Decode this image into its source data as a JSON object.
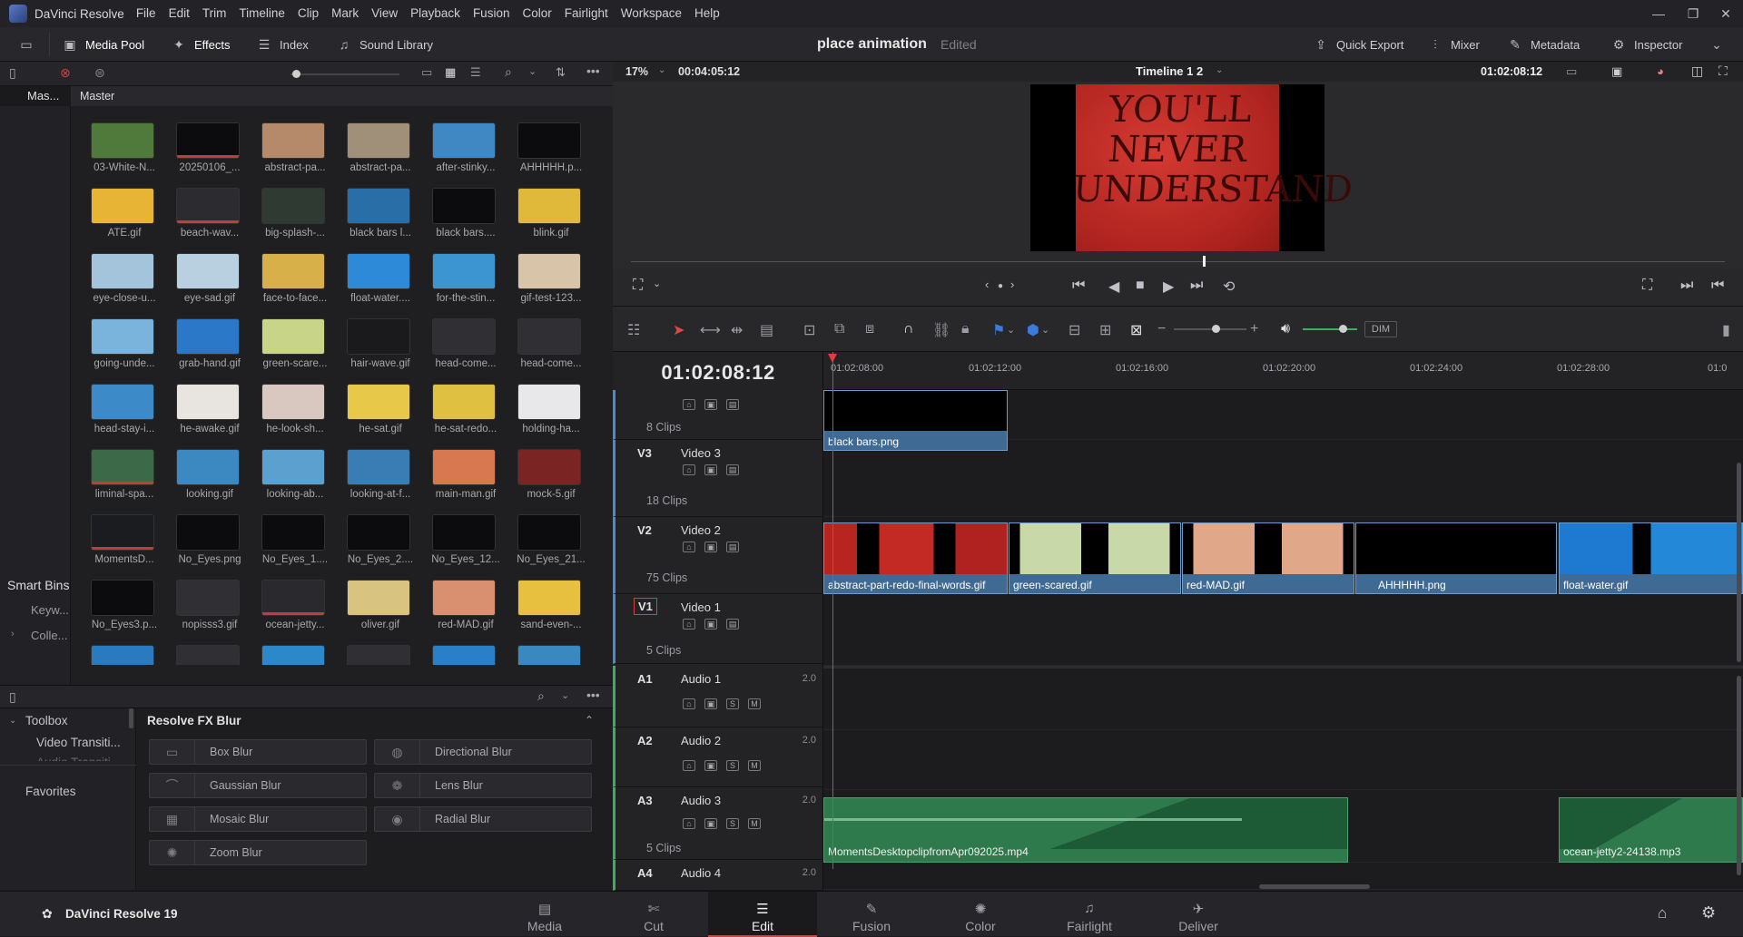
{
  "menubar": {
    "app_name": "DaVinci Resolve",
    "items": [
      "File",
      "Edit",
      "Trim",
      "Timeline",
      "Clip",
      "Mark",
      "View",
      "Playback",
      "Fusion",
      "Color",
      "Fairlight",
      "Workspace",
      "Help"
    ]
  },
  "toolbar": {
    "media_pool": "Media Pool",
    "effects": "Effects",
    "index": "Index",
    "sound_library": "Sound Library",
    "project_title": "place animation",
    "project_status": "Edited",
    "quick_export": "Quick Export",
    "mixer": "Mixer",
    "metadata": "Metadata",
    "inspector": "Inspector"
  },
  "bins": {
    "master_short": "Mas...",
    "smart_bins": "Smart Bins",
    "keywords": "Keyw...",
    "collections": "Colle..."
  },
  "pool": {
    "header": "Master",
    "clips": [
      {
        "name": "03-White-N...",
        "color": "#4f7a3c",
        "red": false
      },
      {
        "name": "20250106_...",
        "color": "#0c0c0e",
        "red": true
      },
      {
        "name": "abstract-pa...",
        "color": "#b58a6a",
        "red": false
      },
      {
        "name": "abstract-pa...",
        "color": "#a0907a",
        "red": false
      },
      {
        "name": "after-stinky...",
        "color": "#3f88c4",
        "red": false
      },
      {
        "name": "AHHHHH.p...",
        "color": "#0c0c0e",
        "red": false
      },
      {
        "name": "ATE.gif",
        "color": "#e7b435",
        "red": false
      },
      {
        "name": "beach-wav...",
        "color": "#2c2c30",
        "red": true
      },
      {
        "name": "big-splash-...",
        "color": "#2f3a33",
        "red": false
      },
      {
        "name": "black bars l...",
        "color": "#2a6ea8",
        "red": false
      },
      {
        "name": "black bars....",
        "color": "#0c0c0e",
        "red": false
      },
      {
        "name": "blink.gif",
        "color": "#e0b83a",
        "red": false
      },
      {
        "name": "eye-close-u...",
        "color": "#a4c4dc",
        "red": false
      },
      {
        "name": "eye-sad.gif",
        "color": "#b8d0e0",
        "red": false
      },
      {
        "name": "face-to-face...",
        "color": "#d8b04a",
        "red": false
      },
      {
        "name": "float-water....",
        "color": "#2c8ad8",
        "red": false
      },
      {
        "name": "for-the-stin...",
        "color": "#3c94d0",
        "red": false
      },
      {
        "name": "gif-test-123...",
        "color": "#d8c4a8",
        "red": false
      },
      {
        "name": "going-unde...",
        "color": "#7ab4dc",
        "red": false
      },
      {
        "name": "grab-hand.gif",
        "color": "#2c78c8",
        "red": false
      },
      {
        "name": "green-scare...",
        "color": "#c8d488",
        "red": false
      },
      {
        "name": "hair-wave.gif",
        "color": "#1a1a1c",
        "red": false
      },
      {
        "name": "head-come...",
        "color": "#303034",
        "red": false
      },
      {
        "name": "head-come...",
        "color": "#303034",
        "red": false
      },
      {
        "name": "head-stay-i...",
        "color": "#3c8ac8",
        "red": false
      },
      {
        "name": "he-awake.gif",
        "color": "#e8e4e0",
        "red": false
      },
      {
        "name": "he-look-sh...",
        "color": "#d8c8c0",
        "red": false
      },
      {
        "name": "he-sat.gif",
        "color": "#e8c848",
        "red": false
      },
      {
        "name": "he-sat-redo...",
        "color": "#e0c040",
        "red": false
      },
      {
        "name": "holding-ha...",
        "color": "#e8e8ea",
        "red": false
      },
      {
        "name": "liminal-spa...",
        "color": "#3c6a48",
        "red": true
      },
      {
        "name": "looking.gif",
        "color": "#3c88c0",
        "red": false
      },
      {
        "name": "looking-ab...",
        "color": "#5ca0d0",
        "red": false
      },
      {
        "name": "looking-at-f...",
        "color": "#3a7cb4",
        "red": false
      },
      {
        "name": "main-man.gif",
        "color": "#d87850",
        "red": false
      },
      {
        "name": "mock-5.gif",
        "color": "#7a2424",
        "red": false
      },
      {
        "name": "MomentsD...",
        "color": "#1a1c20",
        "red": true
      },
      {
        "name": "No_Eyes.png",
        "color": "#0c0c0e",
        "red": false
      },
      {
        "name": "No_Eyes_1....",
        "color": "#0c0c0e",
        "red": false
      },
      {
        "name": "No_Eyes_2....",
        "color": "#0c0c0e",
        "red": false
      },
      {
        "name": "No_Eyes_12...",
        "color": "#0c0c0e",
        "red": false
      },
      {
        "name": "No_Eyes_21...",
        "color": "#0c0c0e",
        "red": false
      },
      {
        "name": "No_Eyes3.p...",
        "color": "#0c0c0e",
        "red": false
      },
      {
        "name": "nopisss3.gif",
        "color": "#303034",
        "red": false
      },
      {
        "name": "ocean-jetty...",
        "color": "#2a2a2e",
        "red": true
      },
      {
        "name": "oliver.gif",
        "color": "#d8c480",
        "red": false
      },
      {
        "name": "red-MAD.gif",
        "color": "#d89070",
        "red": false
      },
      {
        "name": "sand-even-...",
        "color": "#e8c040",
        "red": false
      }
    ]
  },
  "fx": {
    "toolbox": "Toolbox",
    "video_transitions": "Video Transiti...",
    "audio_transitions": "Audio Transiti...",
    "favorites": "Favorites",
    "category": "Resolve FX Blur",
    "items": [
      "Box Blur",
      "Directional Blur",
      "Gaussian Blur",
      "Lens Blur",
      "Mosaic Blur",
      "Radial Blur",
      "Zoom Blur"
    ]
  },
  "viewer": {
    "zoom": "17%",
    "duration": "00:04:05:12",
    "timeline_name": "Timeline 1 2",
    "timecode": "01:02:08:12",
    "frame_text": "YOU'LL NEVER UNDERSTAND"
  },
  "timeline": {
    "timecode": "01:02:08:12",
    "dim": "DIM",
    "ruler": [
      "01:02:08:00",
      "01:02:12:00",
      "01:02:16:00",
      "01:02:20:00",
      "01:02:24:00",
      "01:02:28:00",
      "01:0"
    ],
    "tracks": {
      "v4_count": "8 Clips",
      "v3_id": "V3",
      "v3_name": "Video 3",
      "v3_count": "18 Clips",
      "v2_id": "V2",
      "v2_name": "Video 2",
      "v2_count": "75 Clips",
      "v1_id": "V1",
      "v1_name": "Video 1",
      "v1_count": "5 Clips",
      "a1_id": "A1",
      "a1_name": "Audio 1",
      "a1_ch": "2.0",
      "a2_id": "A2",
      "a2_name": "Audio 2",
      "a2_ch": "2.0",
      "a3_id": "A3",
      "a3_name": "Audio 3",
      "a3_ch": "2.0",
      "a3_count": "5 Clips",
      "a4_id": "A4",
      "a4_name": "Audio 4",
      "a4_ch": "2.0"
    },
    "clips": {
      "black_bars": "black bars.png",
      "abstract": "abstract-part-redo-final-words.gif",
      "green_scared": "green-scared.gif",
      "red_mad": "red-MAD.gif",
      "ahhhhh": "AHHHHH.png",
      "float_water": "float-water.gif",
      "moments": "MomentsDesktopclipfromApr092025.mp4",
      "ocean_jetty": "ocean-jetty2-24138.mp3"
    }
  },
  "pages": {
    "brand": "DaVinci Resolve 19",
    "items": [
      "Media",
      "Cut",
      "Edit",
      "Fusion",
      "Color",
      "Fairlight",
      "Deliver"
    ],
    "active": "Edit"
  }
}
